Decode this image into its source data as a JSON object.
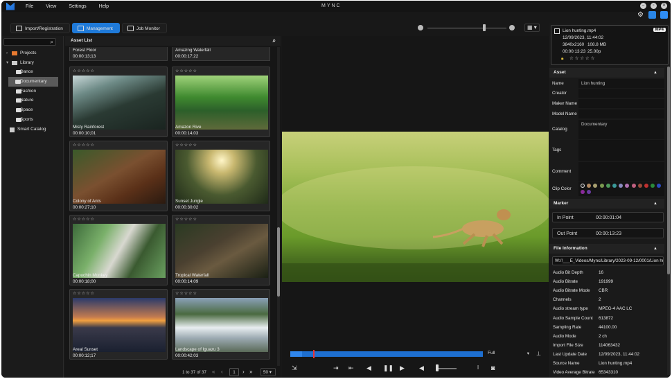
{
  "app": {
    "brand": "MYNC"
  },
  "menu": [
    "File",
    "View",
    "Settings",
    "Help"
  ],
  "tabs": [
    {
      "label": "Import/Registration"
    },
    {
      "label": "Management"
    },
    {
      "label": "Job Monitor"
    }
  ],
  "tree": {
    "projects": "Projects",
    "library": "Library",
    "folders": [
      "Dance",
      "Documentary",
      "Fashion",
      "Nature",
      "Space",
      "Sports"
    ],
    "smart_catalog": "Smart Catalog"
  },
  "asset_list": {
    "title": "Asset List",
    "stars": "☆☆☆☆☆",
    "top_items": [
      {
        "name": "Forest Floor",
        "duration": "00:00:13;13"
      },
      {
        "name": "Amazing Waterfall",
        "duration": "00:00:17;22"
      }
    ],
    "items": [
      {
        "name": "Misty Rainforest",
        "duration": "00:00:10;01"
      },
      {
        "name": "Amazon Rive",
        "duration": "00:00:14;03"
      },
      {
        "name": "Colony of Ants",
        "duration": "00:00:27;10"
      },
      {
        "name": "Sunset Jungle",
        "duration": "00:00:30;02"
      },
      {
        "name": "Capuchin Monkey",
        "duration": "00:00:18;00"
      },
      {
        "name": "Tropical Waterfall",
        "duration": "00:00:14;09"
      },
      {
        "name": "Areal Sunset",
        "duration": "00:00:12;17"
      },
      {
        "name": "Landscape of Iguazu 3",
        "duration": "00:00:42;03"
      }
    ],
    "pager": {
      "range": "1 to 37 of 37",
      "page": "1",
      "per_page": "50"
    }
  },
  "player": {
    "quality": "Full",
    "progress": 0.06
  },
  "info": {
    "filename": "Lion hunting.mp4",
    "datetime": "12/09/2023, 11:44:02",
    "resolution": "3840x2160",
    "size": "108.8 MB",
    "duration": "00:00:13:23",
    "fps": "25.00p",
    "format": "MP4",
    "stars": "☆☆☆☆☆"
  },
  "asset": {
    "title": "Asset",
    "fields": [
      {
        "key": "Name",
        "value": "Lion hunting"
      },
      {
        "key": "Creator",
        "value": ""
      },
      {
        "key": "Maker Name",
        "value": ""
      },
      {
        "key": "Model Name",
        "value": ""
      },
      {
        "key": "Catalog",
        "value": "Documentary"
      },
      {
        "key": "Tags",
        "value": ""
      },
      {
        "key": "Comment",
        "value": ""
      },
      {
        "key": "Clip Color",
        "value": ""
      }
    ],
    "clip_colors": [
      "#2a2a2a",
      "#b08860",
      "#a8a070",
      "#7a9a50",
      "#4c9a5a",
      "#3a9a9a",
      "#8a8abf",
      "#b070b0",
      "#c06080",
      "#9a4a3a",
      "#c03030",
      "#2a8a3a",
      "#2a4ac0",
      "#8a2a9a",
      "#6a3aa0"
    ]
  },
  "marker": {
    "title": "Marker",
    "in_label": "In Point",
    "in_value": "00:00:01:04",
    "out_label": "Out Point",
    "out_value": "00:00:13:23"
  },
  "file_info": {
    "title": "File Information",
    "path": "W:/!___E_Videos/Mync/Library/2023-09-12/0001/Lion hunt",
    "rows": [
      {
        "key": "Audio Bit Depth",
        "value": "16"
      },
      {
        "key": "Audio Bitrate",
        "value": "191999"
      },
      {
        "key": "Audio Bitrate Mode",
        "value": "CBR"
      },
      {
        "key": "Channels",
        "value": "2"
      },
      {
        "key": "Audio stream type",
        "value": "MPEG-4 AAC LC"
      },
      {
        "key": "Audio Sample Count",
        "value": "613872"
      },
      {
        "key": "Sampling Rate",
        "value": "44100.00"
      },
      {
        "key": "Audio Mode",
        "value": "2 ch"
      },
      {
        "key": "Import File Size",
        "value": "114063432"
      },
      {
        "key": "Last Update Date",
        "value": "12/09/2023, 11:44:02"
      },
      {
        "key": "Source Name",
        "value": "Lion hunting.mp4"
      },
      {
        "key": "Video Average Bitrate",
        "value": "65343310"
      }
    ]
  }
}
